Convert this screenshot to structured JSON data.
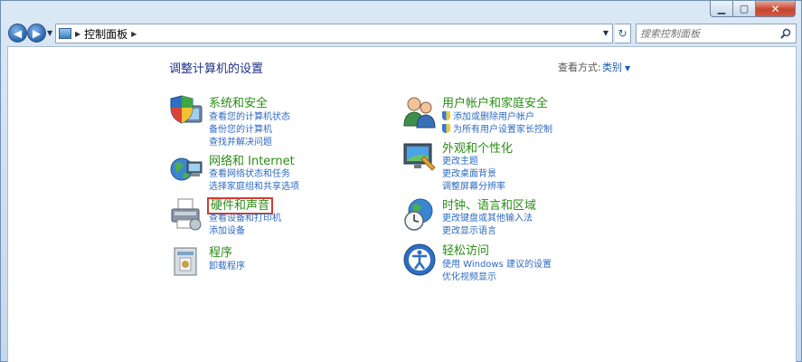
{
  "address": {
    "path": "控制面板"
  },
  "search": {
    "placeholder": "搜索控制面板"
  },
  "header": {
    "title": "调整计算机的设置",
    "view_by_label": "查看方式:",
    "view_by_value": "类别"
  },
  "left_categories": [
    {
      "title": "系统和安全",
      "icon": "shield-computer-icon",
      "links": [
        "查看您的计算机状态",
        "备份您的计算机",
        "查找并解决问题"
      ]
    },
    {
      "title": "网络和 Internet",
      "icon": "network-globe-icon",
      "links": [
        "查看网络状态和任务",
        "选择家庭组和共享选项"
      ]
    },
    {
      "title": "硬件和声音",
      "icon": "printer-icon",
      "links": [
        "查看设备和打印机",
        "添加设备"
      ]
    },
    {
      "title": "程序",
      "icon": "programs-icon",
      "links": [
        "卸载程序"
      ]
    }
  ],
  "right_categories": [
    {
      "title": "用户帐户和家庭安全",
      "icon": "users-icon",
      "links": [
        "添加或删除用户帐户",
        "为所有用户设置家长控制"
      ]
    },
    {
      "title": "外观和个性化",
      "icon": "monitor-icon",
      "links": [
        "更改主题",
        "更改桌面背景",
        "调整屏幕分辨率"
      ]
    },
    {
      "title": "时钟、语言和区域",
      "icon": "clock-globe-icon",
      "links": [
        "更改键盘或其他输入法",
        "更改显示语言"
      ]
    },
    {
      "title": "轻松访问",
      "icon": "ease-of-access-icon",
      "links": [
        "使用 Windows 建议的设置",
        "优化视频显示"
      ]
    }
  ],
  "colors": {
    "category_title": "#2a8d16",
    "link": "#2e6ac2",
    "highlight": "#d63b32"
  }
}
